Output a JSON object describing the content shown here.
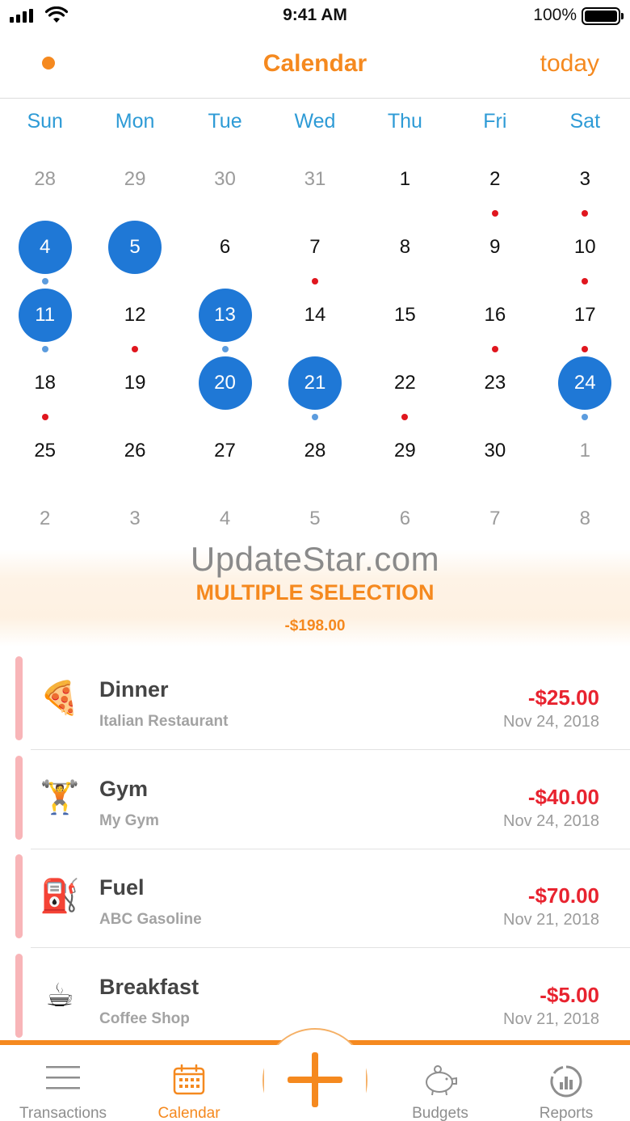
{
  "status_bar": {
    "time": "9:41 AM",
    "battery": "100%"
  },
  "nav": {
    "title": "Calendar",
    "today_label": "today",
    "accent": "#f5891f"
  },
  "weekdays": [
    "Sun",
    "Mon",
    "Tue",
    "Wed",
    "Thu",
    "Fri",
    "Sat"
  ],
  "calendar": {
    "weeks": [
      [
        {
          "d": "28",
          "muted": true
        },
        {
          "d": "29",
          "muted": true
        },
        {
          "d": "30",
          "muted": true
        },
        {
          "d": "31",
          "muted": true
        },
        {
          "d": "1"
        },
        {
          "d": "2",
          "dot": "red"
        },
        {
          "d": "3",
          "dot": "red"
        }
      ],
      [
        {
          "d": "4",
          "selected": true,
          "dot": "blue"
        },
        {
          "d": "5",
          "selected": true
        },
        {
          "d": "6"
        },
        {
          "d": "7",
          "dot": "red"
        },
        {
          "d": "8"
        },
        {
          "d": "9"
        },
        {
          "d": "10",
          "dot": "red"
        }
      ],
      [
        {
          "d": "11",
          "selected": true,
          "dot": "blue"
        },
        {
          "d": "12",
          "dot": "red"
        },
        {
          "d": "13",
          "selected": true,
          "dot": "blue"
        },
        {
          "d": "14"
        },
        {
          "d": "15"
        },
        {
          "d": "16",
          "dot": "red"
        },
        {
          "d": "17",
          "dot": "red"
        }
      ],
      [
        {
          "d": "18",
          "dot": "red"
        },
        {
          "d": "19"
        },
        {
          "d": "20",
          "selected": true
        },
        {
          "d": "21",
          "selected": true,
          "dot": "blue"
        },
        {
          "d": "22",
          "dot": "red"
        },
        {
          "d": "23"
        },
        {
          "d": "24",
          "selected": true,
          "dot": "blue"
        }
      ],
      [
        {
          "d": "25"
        },
        {
          "d": "26"
        },
        {
          "d": "27"
        },
        {
          "d": "28"
        },
        {
          "d": "29"
        },
        {
          "d": "30"
        },
        {
          "d": "1",
          "muted": true
        }
      ],
      [
        {
          "d": "2",
          "muted": true
        },
        {
          "d": "3",
          "muted": true
        },
        {
          "d": "4",
          "muted": true
        },
        {
          "d": "5",
          "muted": true
        },
        {
          "d": "6",
          "muted": true
        },
        {
          "d": "7",
          "muted": true
        },
        {
          "d": "8",
          "muted": true
        }
      ]
    ],
    "selected_color": "#1f78d6",
    "expense_dot_color": "#e0161e",
    "selected_dot_color": "#5c9cde"
  },
  "watermark": "UpdateStar.com",
  "summary": {
    "title": "MULTIPLE SELECTION",
    "total": "-$198.00"
  },
  "transactions": [
    {
      "icon": "pizza-icon",
      "glyph": "🍕",
      "name": "Dinner",
      "place": "Italian Restaurant",
      "amount": "-$25.00",
      "date": "Nov 24, 2018"
    },
    {
      "icon": "weightlifter-icon",
      "glyph": "🏋",
      "name": "Gym",
      "place": "My Gym",
      "amount": "-$40.00",
      "date": "Nov 24, 2018"
    },
    {
      "icon": "fuel-pump-icon",
      "glyph": "⛽",
      "name": "Fuel",
      "place": "ABC Gasoline",
      "amount": "-$70.00",
      "date": "Nov 21, 2018"
    },
    {
      "icon": "coffee-cup-icon",
      "glyph": "☕",
      "name": "Breakfast",
      "place": "Coffee Shop",
      "amount": "-$5.00",
      "date": "Nov 21, 2018"
    }
  ],
  "tabs": {
    "transactions": {
      "label": "Transactions",
      "icon": "hamburger-list-icon"
    },
    "calendar": {
      "label": "Calendar",
      "icon": "calendar-icon",
      "active": true
    },
    "add": {
      "icon": "plus-icon"
    },
    "budgets": {
      "label": "Budgets",
      "icon": "piggy-bank-icon"
    },
    "reports": {
      "label": "Reports",
      "icon": "chart-gauge-icon"
    }
  }
}
